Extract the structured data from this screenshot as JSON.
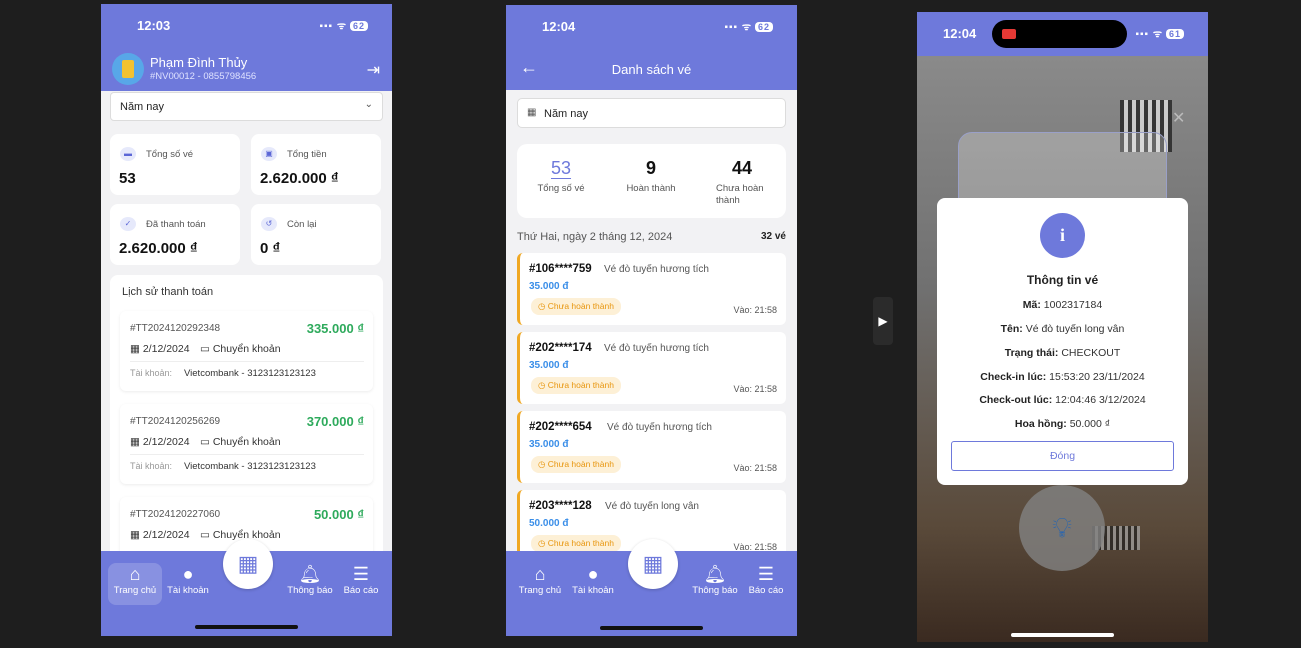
{
  "phone1": {
    "status": {
      "time": "12:03",
      "signal": "▪▪▪ ᯤ",
      "battery": "62"
    },
    "user": {
      "name": "Phạm Đình Thủy",
      "sub": "#NV00012 - 0855798456"
    },
    "filter": "Năm nay",
    "stats": [
      {
        "label": "Tổng số vé",
        "value": "53",
        "icon": "ticket-icon"
      },
      {
        "label": "Tổng tiền",
        "value": "2.620.000 ₫",
        "icon": "money-icon"
      },
      {
        "label": "Đã thanh toán",
        "value": "2.620.000 ₫",
        "icon": "check-icon"
      },
      {
        "label": "Còn lại",
        "value": "0 ₫",
        "icon": "history-icon"
      }
    ],
    "history": {
      "title": "Lịch sử thanh toán",
      "items": [
        {
          "code": "#TT2024120292348",
          "amount": "335.000 ₫",
          "date": "2/12/2024",
          "method": "Chuyển khoản",
          "account_label": "Tài khoản:",
          "account": "Vietcombank - 3123123123123"
        },
        {
          "code": "#TT2024120256269",
          "amount": "370.000 ₫",
          "date": "2/12/2024",
          "method": "Chuyển khoản",
          "account_label": "Tài khoản:",
          "account": "Vietcombank - 3123123123123"
        },
        {
          "code": "#TT2024120227060",
          "amount": "50.000 ₫",
          "date": "2/12/2024",
          "method": "Chuyển khoản"
        }
      ]
    },
    "tabs": [
      "Trang chủ",
      "Tài khoản",
      "Thông báo",
      "Báo cáo"
    ]
  },
  "phone2": {
    "status": {
      "time": "12:04",
      "signal": "▪▪▪ ᯤ",
      "battery": "62"
    },
    "title": "Danh sách vé",
    "filter": "Năm nay",
    "summary": [
      {
        "value": "53",
        "label": "Tổng số vé"
      },
      {
        "value": "9",
        "label": "Hoàn thành"
      },
      {
        "value": "44",
        "label": "Chưa hoàn thành"
      }
    ],
    "day": {
      "label": "Thứ Hai, ngày 2 tháng 12, 2024",
      "count": "32 vé"
    },
    "tickets": [
      {
        "id": "#106****759",
        "name": "Vé đò tuyến hương tích",
        "price": "35.000 đ",
        "status": "Chưa hoàn thành",
        "in": "Vào: 21:58"
      },
      {
        "id": "#202****174",
        "name": "Vé đò tuyến hương tích",
        "price": "35.000 đ",
        "status": "Chưa hoàn thành",
        "in": "Vào: 21:58"
      },
      {
        "id": "#202****654",
        "name": "Vé đò tuyến hương tích",
        "price": "35.000 đ",
        "status": "Chưa hoàn thành",
        "in": "Vào: 21:58"
      },
      {
        "id": "#203****128",
        "name": "Vé đò tuyến long vân",
        "price": "50.000 đ",
        "status": "Chưa hoàn thành",
        "in": "Vào: 21:58"
      }
    ],
    "tabs": [
      "Trang chủ",
      "Tài khoản",
      "Thông báo",
      "Báo cáo"
    ]
  },
  "phone3": {
    "status": {
      "time": "12:04",
      "signal": "▪▪▪ ᯤ",
      "battery": "61"
    },
    "modal": {
      "title": "Thông tin vé",
      "rows": [
        {
          "label": "Mã:",
          "value": "1002317184"
        },
        {
          "label": "Tên:",
          "value": "Vé đò tuyến long vân"
        },
        {
          "label": "Trạng thái:",
          "value": "CHECKOUT"
        },
        {
          "label": "Check-in lúc:",
          "value": "15:53:20 23/11/2024"
        },
        {
          "label": "Check-out lúc:",
          "value": "12:04:46 3/12/2024"
        },
        {
          "label": "Hoa hồng:",
          "value": "50.000 ₫"
        }
      ],
      "button": "Đóng"
    }
  },
  "colors": {
    "primary": "#6e79db",
    "amount_green": "#2eaa5c",
    "price_blue": "#3a8ee8",
    "pending_orange": "#e8960e"
  }
}
